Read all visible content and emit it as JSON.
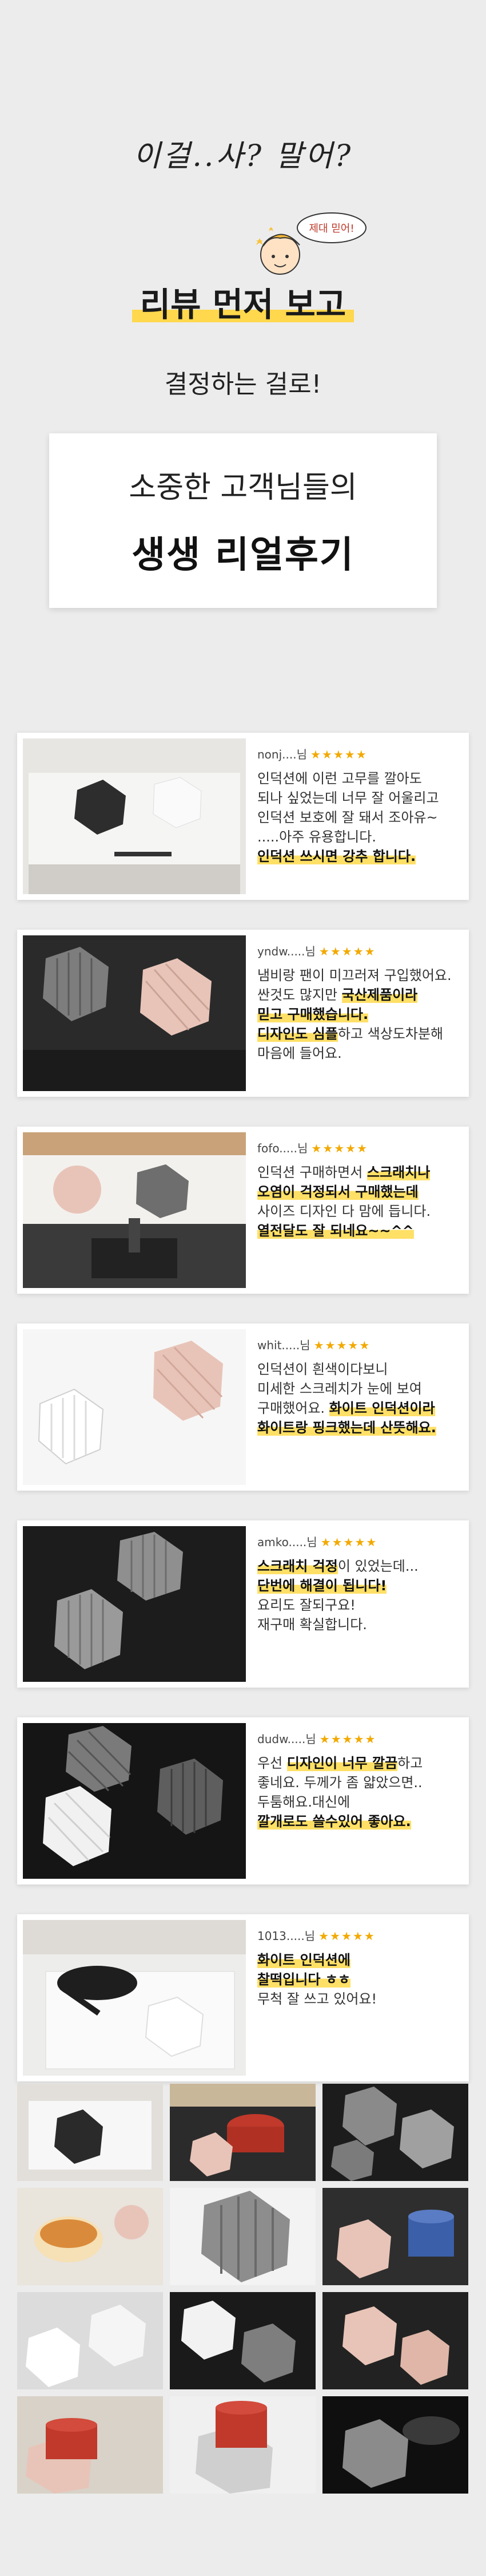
{
  "header": {
    "handwritten": "이걸..사? 말어?",
    "mascot_bubble": "제대 믿어!",
    "title": "리뷰 먼저 보고",
    "subtitle": "결정하는 걸로!",
    "banner_line1": "소중한 고객님들의",
    "banner_line2": "생생 리얼후기"
  },
  "colors": {
    "highlight": "#ffe066",
    "star": "#f2a900",
    "mat_pink": "#e8c4b8",
    "mat_gray": "#8f8f8f"
  },
  "reviews": [
    {
      "reviewer": "nonj....님",
      "stars": "★★★★★",
      "lines": [
        {
          "text": "인덕션에 이런 고무를 깔아도",
          "hl": false
        },
        {
          "text": "되나 싶었는데 너무 잘 어울리고",
          "hl": false
        },
        {
          "text": "인덕션 보호에 잘 돼서 조아유~",
          "hl": false
        },
        {
          "text": ".....아주 유용합니다.",
          "hl": false
        },
        {
          "text": "인덕션 쓰시면 강추 합니다.",
          "hl": true
        }
      ]
    },
    {
      "reviewer": "yndw.....님",
      "stars": "★★★★★",
      "lines": [
        {
          "text": "냄비랑 팬이 미끄러져 구입했어요.",
          "hl": false
        },
        {
          "text": "싼것도 많지만 국산제품이라",
          "hl": false,
          "mark": "국산제품이라"
        },
        {
          "text": "믿고 구매했습니다.",
          "hl": true
        },
        {
          "text": "디자인도 심플하고 색상도차분해",
          "hl": false,
          "mark": "디자인도 심플"
        },
        {
          "text": "마음에 들어요.",
          "hl": false
        }
      ]
    },
    {
      "reviewer": "fofo.....님",
      "stars": "★★★★★",
      "lines": [
        {
          "text": "인덕션 구매하면서 스크래치나",
          "hl": false,
          "mark": "스크래치나"
        },
        {
          "text": "오염이 걱정되서 구매했는데",
          "hl": true
        },
        {
          "text": "사이즈 디자인 다 맘에 듭니다.",
          "hl": false
        },
        {
          "text": "열전달도 잘 되네요~~^^",
          "hl": true
        }
      ]
    },
    {
      "reviewer": "whit.....님",
      "stars": "★★★★★",
      "lines": [
        {
          "text": "인덕션이 흰색이다보니",
          "hl": false
        },
        {
          "text": "미세한 스크레치가 눈에 보여",
          "hl": false
        },
        {
          "text": "구매했어요. 화이트 인덕션이라",
          "hl": false,
          "mark": "화이트 인덕션이라"
        },
        {
          "text": "화이트랑 핑크했는데 산뜻해요.",
          "hl": true
        }
      ]
    },
    {
      "reviewer": "amko.....님",
      "stars": "★★★★★",
      "lines": [
        {
          "text": "스크래치 걱정이 있었는데...",
          "hl": false,
          "mark": "스크래치 걱정"
        },
        {
          "text": "단번에 해결이 됩니다!",
          "hl": true
        },
        {
          "text": "요리도 잘되구요!",
          "hl": false
        },
        {
          "text": "재구매 확실합니다.",
          "hl": false
        }
      ]
    },
    {
      "reviewer": "dudw.....님",
      "stars": "★★★★★",
      "lines": [
        {
          "text": "우선 디자인이 너무 깔끔하고",
          "hl": false,
          "mark": "디자인이 너무 깔끔"
        },
        {
          "text": "좋네요. 두께가 좀 얇았으면..",
          "hl": false
        },
        {
          "text": "두툼해요.대신에",
          "hl": false
        },
        {
          "text": "깔개로도 쓸수있어 좋아요.",
          "hl": true
        }
      ]
    },
    {
      "reviewer": "1013.....님",
      "stars": "★★★★★",
      "lines": [
        {
          "text": "화이트 인덕션에",
          "hl": true
        },
        {
          "text": "찰떡입니다 ㅎㅎ",
          "hl": true
        },
        {
          "text": "무척 잘 쓰고 있어요!",
          "hl": false
        }
      ]
    }
  ],
  "gallery_photos": [
    "black-mat-cooktop",
    "red-pot-cooktop",
    "gray-mats-cooktop",
    "food-bowl-counter",
    "gray-mat-closeup",
    "pink-pot-stove",
    "white-mats-counter",
    "dark-cooktop-mats",
    "pink-mats-dark",
    "pink-pot-red",
    "red-pot-mat",
    "dark-glass-pan"
  ]
}
